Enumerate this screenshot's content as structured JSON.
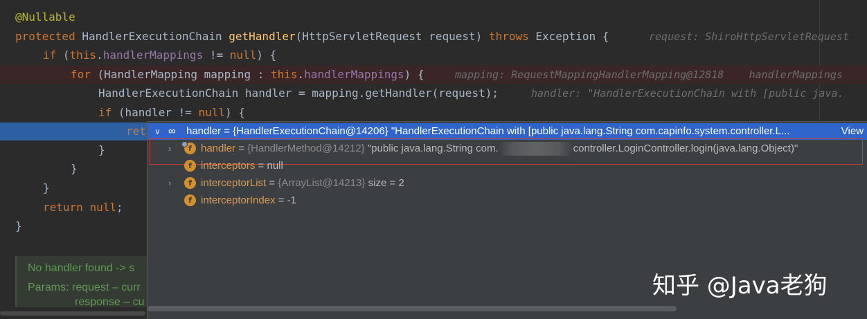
{
  "code": {
    "line1": "@Nullable",
    "line2_kw": "protected",
    "line2_type": " HandlerExecutionChain ",
    "line2_fn": "getHandler",
    "line2_params": "(HttpServletRequest request) ",
    "line2_throws": "throws",
    "line2_tail": " Exception {",
    "line2_hint": "request: ShiroHttpServletRequest",
    "line3_if": "if",
    "line3_open": " (",
    "line3_this": "this",
    "line3_dot": ".",
    "line3_field": "handlerMappings",
    "line3_ne": " != ",
    "line3_null": "null",
    "line3_close": ") {",
    "line4_for": "for",
    "line4_mid": " (HandlerMapping mapping : ",
    "line4_this": "this",
    "line4_dot": ".",
    "line4_field": "handlerMappings",
    "line4_close": ") {",
    "line4_hint": "mapping: RequestMappingHandlerMapping@12818    handlerMappings",
    "line5": "HandlerExecutionChain handler = mapping.getHandler(request);",
    "line5_hint": "handler: \"HandlerExecutionChain with [public java.",
    "line6_if": "if",
    "line6_mid": " (handler != ",
    "line6_null": "null",
    "line6_close": ") {",
    "line7": "ret",
    "line8": "}",
    "line9": "}",
    "line10": "}",
    "line11_kw": "return",
    "line11_sp": " ",
    "line11_null": "null",
    "line11_semi": ";",
    "line12": "}"
  },
  "javadoc": {
    "line1": "No handler found -> s",
    "line2": "Params: request – curr",
    "line3": "response – cu"
  },
  "popup": {
    "header_text": "handler = {HandlerExecutionChain@14206} \"HandlerExecutionChain with [public java.lang.String com.capinfo.system.controller.L...",
    "view_link": "View",
    "rows": [
      {
        "name": "handler",
        "eq": " = ",
        "id": "{HandlerMethod@14212}",
        "value_a": " \"public java.lang.String com.",
        "value_b": "controller.LoginController.login(java.lang.Object)\""
      },
      {
        "name": "interceptors",
        "eq": " = ",
        "value": "null"
      },
      {
        "name": "interceptorList",
        "eq": " = ",
        "id": "{ArrayList@14213}",
        "value": " size = 2"
      },
      {
        "name": "interceptorIndex",
        "eq": " = ",
        "value": "-1"
      }
    ],
    "field_icon_letter": "f",
    "expand_icon": "›",
    "collapse_icon": "∨",
    "watch_icon": "∞"
  },
  "watermark": "知乎 @Java老狗",
  "colors": {
    "background": "#2b2b2b",
    "keyword": "#cc7832",
    "method": "#ffc66d",
    "field": "#9876aa",
    "annotation": "#bbb529",
    "selection": "#2d5fa3",
    "breakpoint_line": "#3a2626",
    "popup_header": "#2f65ca",
    "field_icon": "#d28f2c",
    "highlight_box": "#c43c3c"
  }
}
